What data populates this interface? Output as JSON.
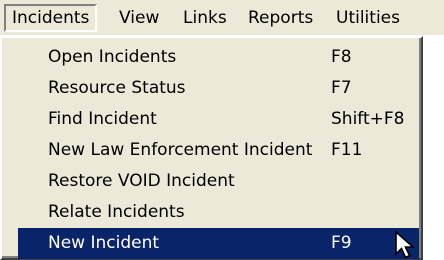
{
  "menubar": {
    "items": [
      {
        "label": "Incidents"
      },
      {
        "label": "View"
      },
      {
        "label": "Links"
      },
      {
        "label": "Reports"
      },
      {
        "label": "Utilities"
      }
    ]
  },
  "dropdown": {
    "items": [
      {
        "label": "Open Incidents",
        "shortcut": "F8"
      },
      {
        "label": "Resource Status",
        "shortcut": "F7"
      },
      {
        "label": "Find Incident",
        "shortcut": "Shift+F8"
      },
      {
        "label": "New Law Enforcement Incident",
        "shortcut": "F11"
      },
      {
        "label": "Restore VOID Incident",
        "shortcut": ""
      },
      {
        "label": "Relate Incidents",
        "shortcut": ""
      },
      {
        "label": "New Incident",
        "shortcut": "F9"
      }
    ]
  },
  "colors": {
    "highlight": "#0a246a",
    "menu_background": "#ece9d8"
  },
  "cursor": {
    "icon": "arrow-cursor-icon"
  }
}
